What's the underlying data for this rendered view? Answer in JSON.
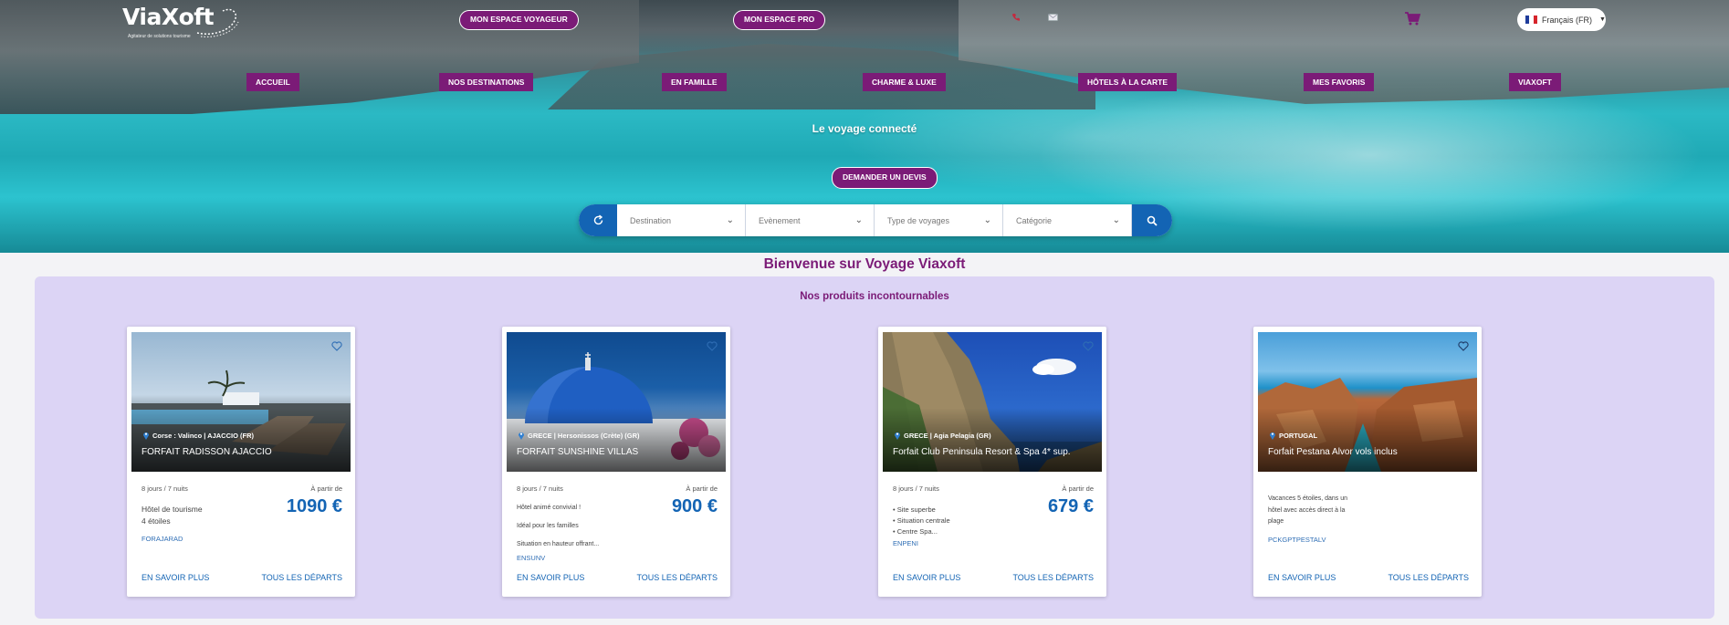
{
  "header": {
    "logo_text": "ViaXoft",
    "logo_tagline": "Agitateur de solutions tourisme",
    "btn_voyageur": "MON ESPACE VOYAGEUR",
    "btn_pro": "MON ESPACE PRO",
    "phone_icon": "phone-icon",
    "mail_icon": "mail-icon",
    "cart_icon": "cart-icon",
    "language": "Français (FR)"
  },
  "nav": {
    "items": [
      {
        "label": "ACCUEIL"
      },
      {
        "label": "NOS DESTINATIONS"
      },
      {
        "label": "EN FAMILLE"
      },
      {
        "label": "CHARME & LUXE"
      },
      {
        "label": "HÔTELS À LA CARTE"
      },
      {
        "label": "MES FAVORIS"
      },
      {
        "label": "VIAXOFT"
      }
    ]
  },
  "hero": {
    "title": "Le voyage connecté",
    "quote_button": "DEMANDER UN DEVIS"
  },
  "search": {
    "destination": "Destination",
    "event": "Evènement",
    "travel_type": "Type de voyages",
    "category": "Catégorie"
  },
  "main": {
    "welcome": "Bienvenue sur Voyage Viaxoft",
    "section_title": "Nos produits incontournables"
  },
  "products": [
    {
      "location": "Corse : Valinco | AJACCIO (FR)",
      "name": "FORFAIT RADISSON AJACCIO",
      "duration": "8 jours / 7 nuits",
      "from_label": "À partir de",
      "price": "1090 €",
      "desc": [
        "Hôtel de tourisme",
        "4 étoiles"
      ],
      "code": "FORAJARAD",
      "more": "EN SAVOIR PLUS",
      "departures": "TOUS LES DÉPARTS"
    },
    {
      "location": "GRECE | Hersonissos (Crète) (GR)",
      "name": "FORFAIT SUNSHINE VILLAS",
      "duration": "8 jours / 7 nuits",
      "from_label": "À partir de",
      "price": "900 €",
      "desc": [
        "Hôtel animé convivial !",
        "Idéal pour les familles",
        "Situation en hauteur offrant..."
      ],
      "code": "ENSUNV",
      "more": "EN SAVOIR PLUS",
      "departures": "TOUS LES DÉPARTS"
    },
    {
      "location": "GRECE | Agia Pelagia (GR)",
      "name": "Forfait Club Peninsula Resort & Spa 4* sup.",
      "duration": "8 jours / 7 nuits",
      "from_label": "À partir de",
      "price": "679 €",
      "desc": [
        "• Site superbe",
        "• Situation centrale",
        "• Centre Spa..."
      ],
      "code": "ENPENI",
      "more": "EN SAVOIR PLUS",
      "departures": "TOUS LES DÉPARTS"
    },
    {
      "location": "PORTUGAL",
      "name": "Forfait Pestana Alvor vols inclus",
      "duration": "",
      "from_label": "",
      "price": "",
      "desc": [
        "Vacances 5 étoiles, dans un",
        "hôtel avec accès direct à la",
        "plage"
      ],
      "code": "PCKGPTPESTALV",
      "more": "EN SAVOIR PLUS",
      "departures": "TOUS LES DÉPARTS"
    }
  ],
  "colors": {
    "brand_purple": "#7b1b77",
    "brand_blue": "#1364b4",
    "panel_lavender": "#dcd4f5"
  }
}
